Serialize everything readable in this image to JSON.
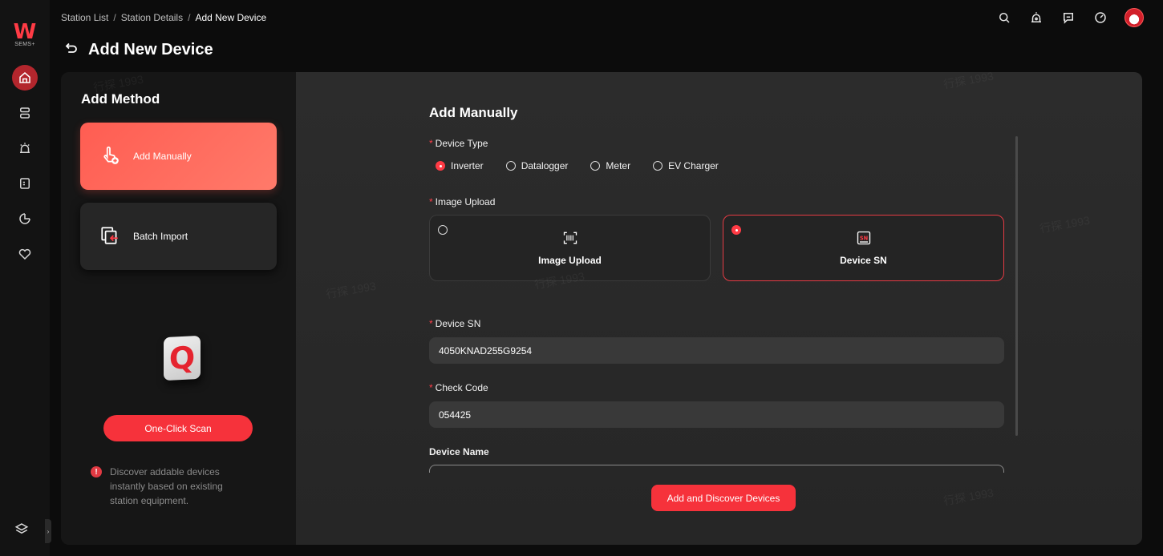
{
  "logo": {
    "mark": "W",
    "text": "SEMS+"
  },
  "breadcrumb": {
    "items": [
      "Station List",
      "Station Details",
      "Add New Device"
    ],
    "separator": "/"
  },
  "page": {
    "title": "Add New Device"
  },
  "header_icons": [
    "search-icon",
    "alarm-icon",
    "message-icon",
    "speed-icon",
    "avatar"
  ],
  "sidebar": {
    "icons": [
      "home-icon",
      "devices-icon",
      "alarm-icon",
      "report-icon",
      "analytics-icon",
      "service-icon"
    ],
    "bottom": "layers-icon"
  },
  "method": {
    "title": "Add Method",
    "manual_label": "Add Manually",
    "batch_label": "Batch Import",
    "scan_button": "One-Click Scan",
    "hint": "Discover addable devices instantly based on existing station equipment."
  },
  "form": {
    "title": "Add Manually",
    "device_type_label": "Device Type",
    "device_types": [
      "Inverter",
      "Datalogger",
      "Meter",
      "EV Charger"
    ],
    "device_type_selected": "Inverter",
    "image_upload_label": "Image Upload",
    "upload_options": [
      "Image Upload",
      "Device SN"
    ],
    "upload_selected": "Device SN",
    "device_sn_label": "Device SN",
    "device_sn_value": "4050KNAD255G9254",
    "check_code_label": "Check Code",
    "check_code_value": "054425",
    "device_name_label": "Device Name",
    "submit": "Add and Discover Devices"
  },
  "watermark": "行探 1993",
  "colors": {
    "accent": "#f6323b",
    "background": "#0c0c0c",
    "panel": "#2a2a2a"
  }
}
